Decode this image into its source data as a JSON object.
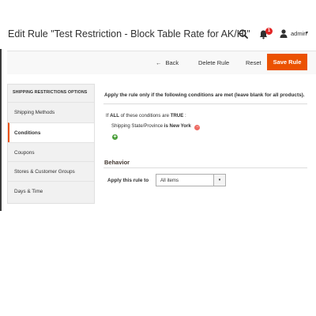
{
  "header": {
    "title": "Edit Rule \"Test Restriction - Block Table Rate for AK/HI\"",
    "search_icon": "search-icon",
    "notification_count": "1",
    "user_icon": "user-icon",
    "user_label": "admin",
    "caret": "▾"
  },
  "actions": {
    "back_arrow": "←",
    "back_label": "Back",
    "delete_label": "Delete Rule",
    "reset_label": "Reset",
    "save_label": "Save Rule",
    "accent_color": "#eb5202"
  },
  "sidebar": {
    "heading": "SHIPPING RESTRICTIONS OPTIONS",
    "items": [
      {
        "label": "Shipping Methods",
        "active": false
      },
      {
        "label": "Conditions",
        "active": true
      },
      {
        "label": "Coupons",
        "active": false
      },
      {
        "label": "Stores & Customer Groups",
        "active": false
      },
      {
        "label": "Days & Time",
        "active": false
      }
    ]
  },
  "conditions": {
    "intro": "Apply the rule only if the following conditions are met (leave blank for all products).",
    "if_prefix": "If",
    "aggregator": "ALL",
    "if_middle": "of these conditions are",
    "value": "TRUE",
    "if_suffix": ":",
    "rule": {
      "attribute": "Shipping State/Province",
      "operator": "is",
      "value": "New York",
      "remove_glyph": "−"
    },
    "add_glyph": "+"
  },
  "behavior": {
    "title": "Behavior",
    "apply_label": "Apply this rule to",
    "apply_value": "All items",
    "select_arrow": "▾"
  }
}
